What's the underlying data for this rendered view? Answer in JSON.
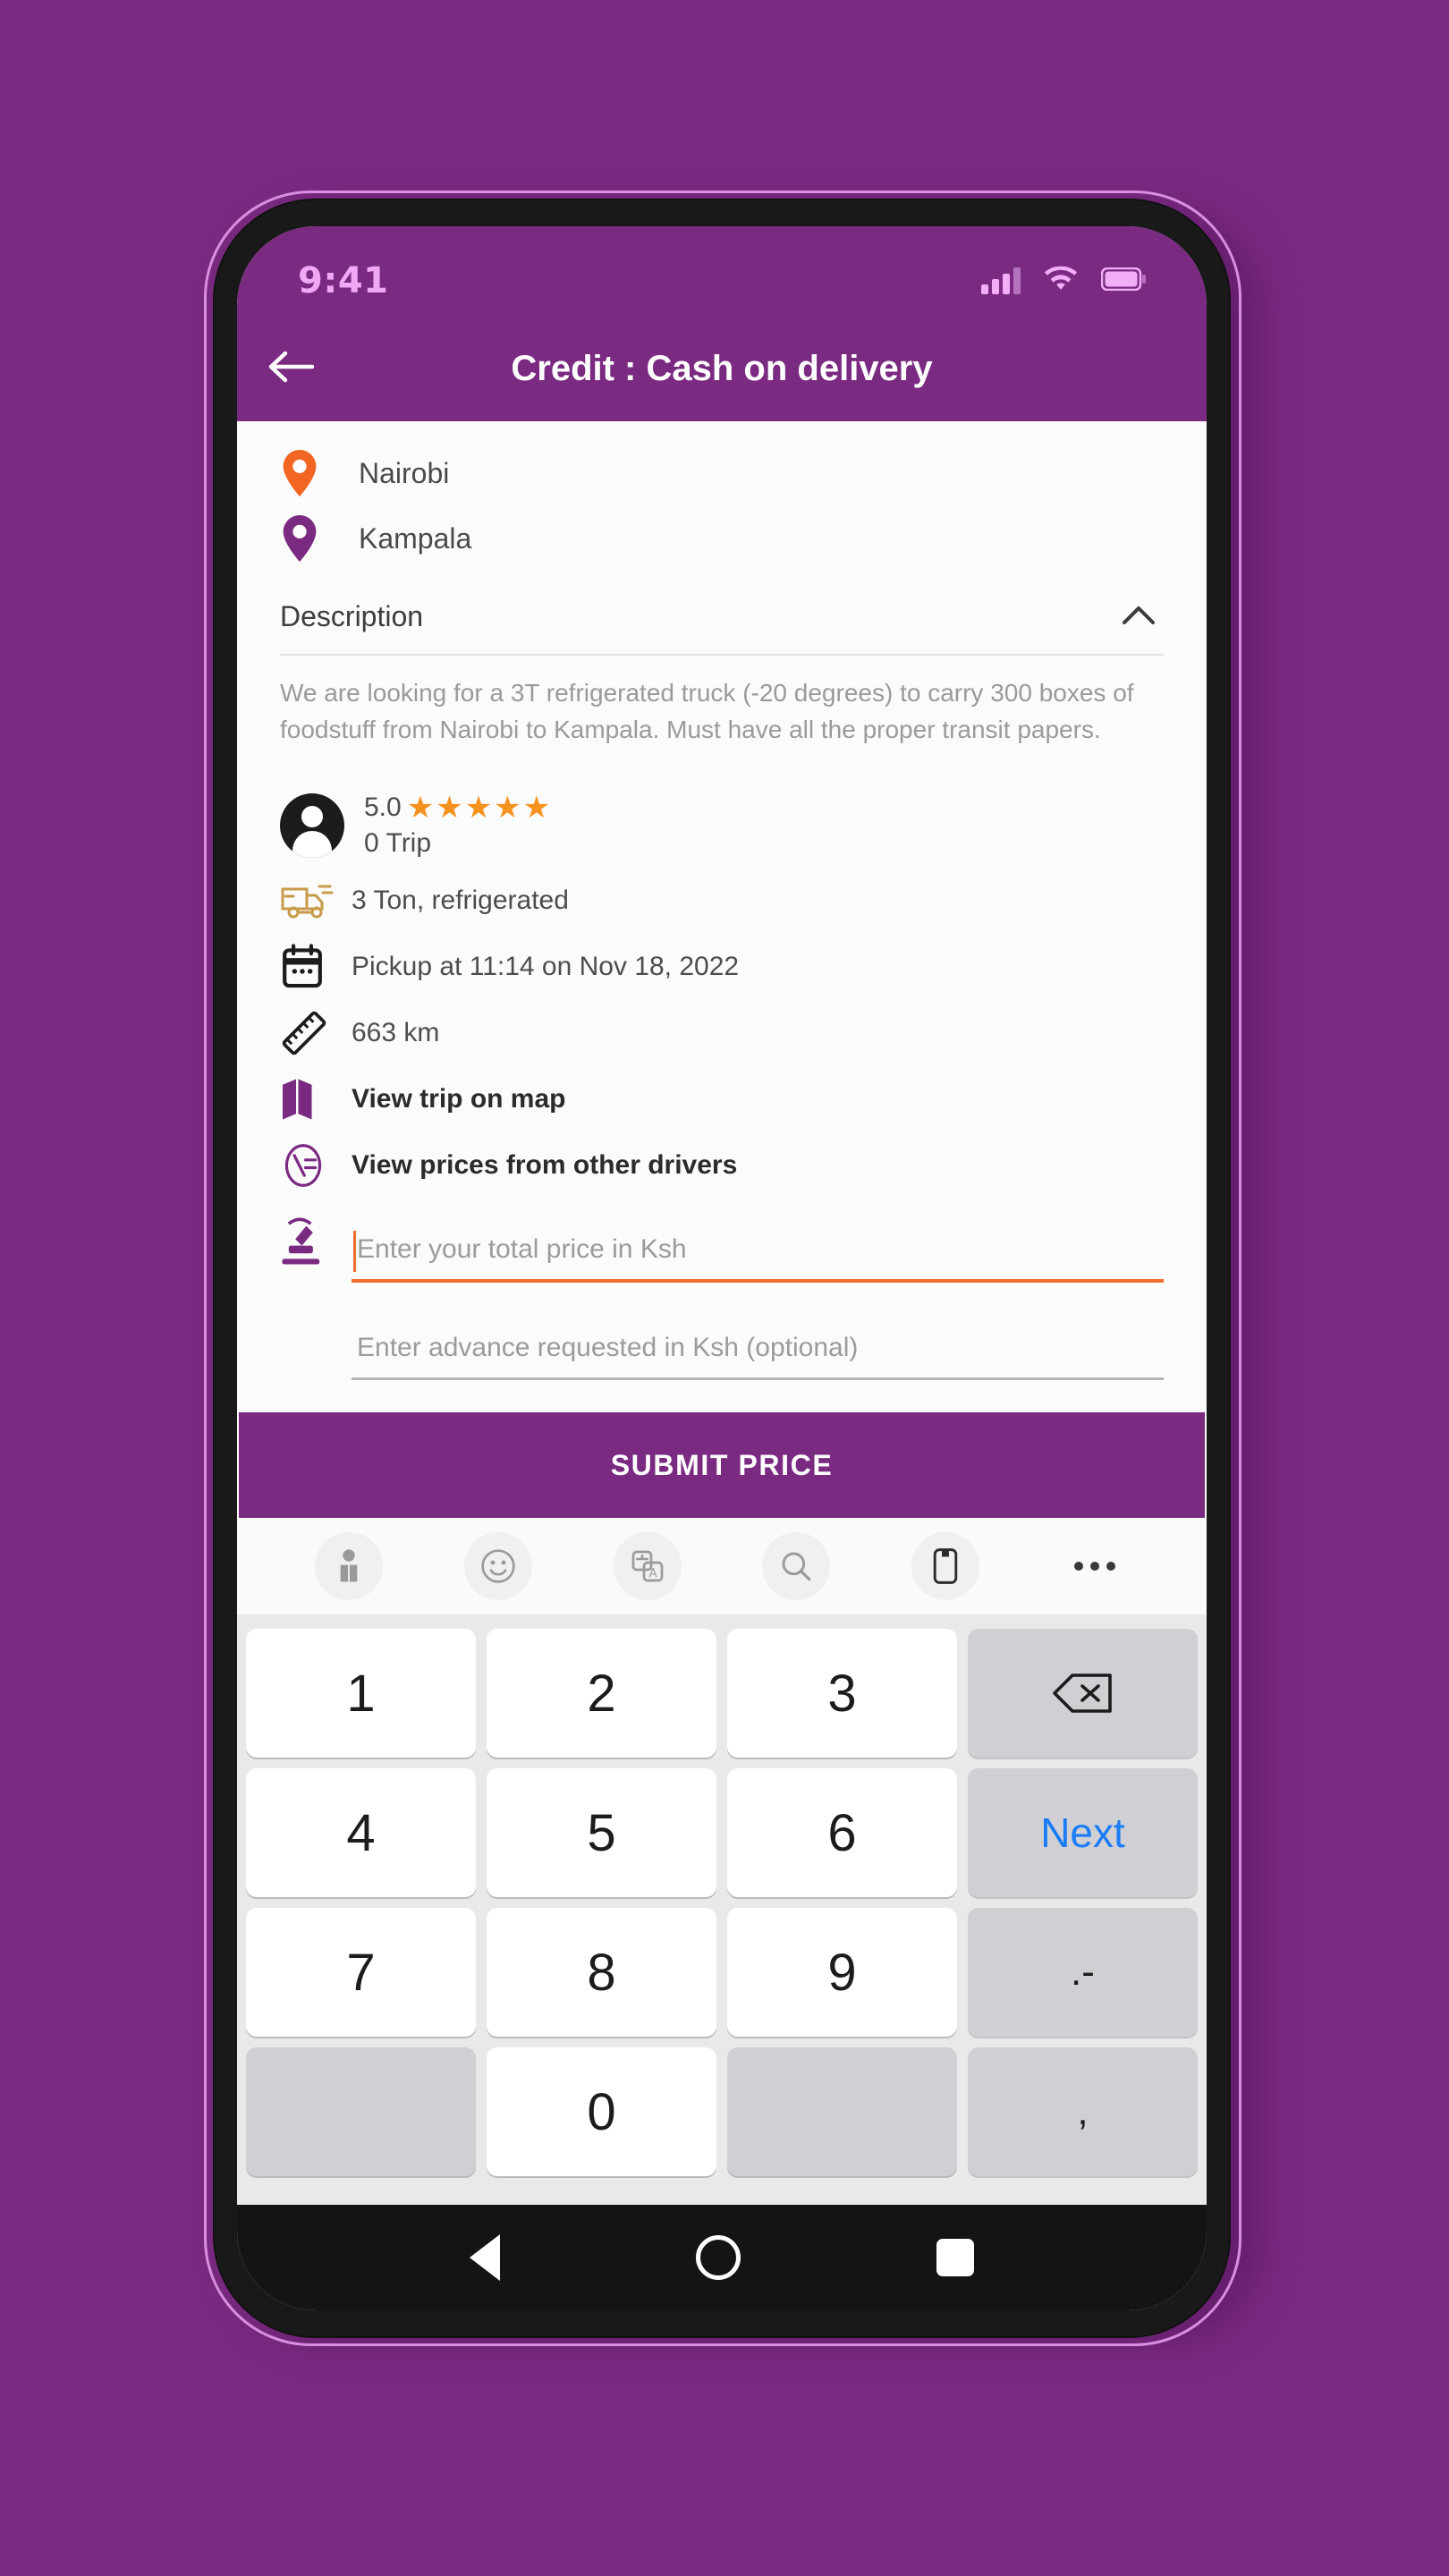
{
  "status_bar": {
    "time": "9:41",
    "icons": [
      "signal-icon",
      "wifi-icon",
      "battery-icon"
    ]
  },
  "app_bar": {
    "back_icon": "arrow-left-icon",
    "title": "Credit : Cash on delivery"
  },
  "trip": {
    "origin": "Nairobi",
    "destination": "Kampala",
    "origin_pin_color": "#F26522",
    "destination_pin_color": "#7B2A82"
  },
  "description": {
    "label": "Description",
    "collapse_icon": "chevron-up-icon",
    "text": "We are looking for a 3T refrigerated truck (-20 degrees) to carry 300 boxes of foodstuff from Nairobi to Kampala. Must have all the proper transit papers."
  },
  "driver": {
    "rating": "5.0",
    "stars": 5,
    "star_color": "#F5921E",
    "trips": "0 Trip"
  },
  "details": [
    {
      "icon": "truck-icon",
      "text": "3 Ton, refrigerated",
      "bold": false
    },
    {
      "icon": "calendar-icon",
      "text": "Pickup at 11:14 on Nov 18, 2022",
      "bold": false
    },
    {
      "icon": "ruler-icon",
      "text": "663 km",
      "bold": false
    },
    {
      "icon": "map-icon",
      "text": "View trip on map",
      "bold": true
    },
    {
      "icon": "price-tag-icon",
      "text": "View prices from other drivers",
      "bold": true
    }
  ],
  "form": {
    "price_icon": "auction-gavel-icon",
    "price_placeholder": "Enter your total price in Ksh",
    "price_value": "",
    "price_focus_color": "#EE6F2D",
    "advance_placeholder": "Enter advance requested in Ksh (optional)",
    "advance_value": "",
    "submit_label": "SUBMIT PRICE",
    "submit_color": "#7B2A82"
  },
  "keyboard": {
    "toolbar_icons": [
      "sticker-person-icon",
      "emoji-icon",
      "translate-icon",
      "search-icon",
      "clipboard-icon",
      "more-options-icon"
    ],
    "rows": [
      [
        {
          "label": "1",
          "type": "num"
        },
        {
          "label": "2",
          "type": "num"
        },
        {
          "label": "3",
          "type": "num"
        },
        {
          "label": "",
          "type": "backspace"
        }
      ],
      [
        {
          "label": "4",
          "type": "num"
        },
        {
          "label": "5",
          "type": "num"
        },
        {
          "label": "6",
          "type": "num"
        },
        {
          "label": "Next",
          "type": "next"
        }
      ],
      [
        {
          "label": "7",
          "type": "num"
        },
        {
          "label": "8",
          "type": "num"
        },
        {
          "label": "9",
          "type": "num"
        },
        {
          "label": ".-",
          "type": "punct"
        }
      ],
      [
        {
          "label": "",
          "type": "blank"
        },
        {
          "label": "0",
          "type": "num"
        },
        {
          "label": "",
          "type": "blank"
        },
        {
          "label": ",",
          "type": "punct"
        }
      ]
    ]
  },
  "nav_bar": {
    "buttons": [
      "back-triangle-icon",
      "home-circle-icon",
      "recents-square-icon"
    ]
  }
}
